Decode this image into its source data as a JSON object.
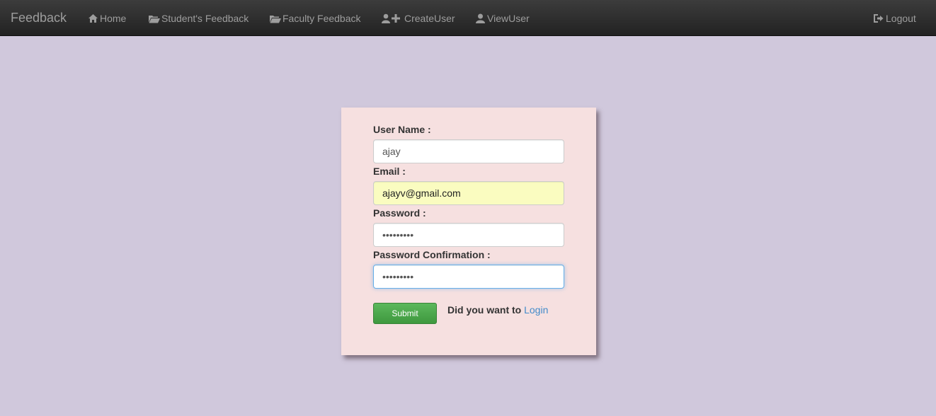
{
  "navbar": {
    "brand": "Feedback",
    "items": [
      {
        "label": "Home",
        "icon": "home-icon"
      },
      {
        "label": "Student's Feedback",
        "icon": "folder-open-icon"
      },
      {
        "label": "Faculty Feedback",
        "icon": "folder-open-icon"
      },
      {
        "label": "CreateUser",
        "icon": "user-plus-icon"
      },
      {
        "label": "ViewUser",
        "icon": "user-icon"
      }
    ],
    "logout": {
      "label": "Logout",
      "icon": "logout-icon"
    },
    "text_color": "#9d9d9d"
  },
  "form": {
    "username_label": "User Name :",
    "username_value": "ajay",
    "email_label": "Email :",
    "email_value": "ajayv@gmail.com",
    "password_label": "Password :",
    "password_value": "passwords",
    "password_confirm_label": "Password Confirmation :",
    "password_confirm_value": "passwords",
    "submit_label": "Submit",
    "login_prompt": "Did you want to",
    "login_link": "Login"
  },
  "colors": {
    "page_background": "#d0c8dc",
    "card_background": "#f6e0e0",
    "submit_green": "#5cb85c",
    "link_blue": "#428bca"
  }
}
